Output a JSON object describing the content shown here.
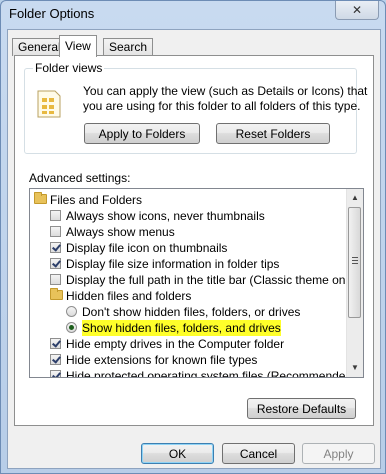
{
  "window": {
    "title": "Folder Options",
    "close_glyph": "✕"
  },
  "tabs": [
    {
      "label": "General",
      "active": false
    },
    {
      "label": "View",
      "active": true
    },
    {
      "label": "Search",
      "active": false
    }
  ],
  "folder_views": {
    "group_label": "Folder views",
    "description_line1": "You can apply the view (such as Details or Icons) that",
    "description_line2": "you are using for this folder to all folders of this type.",
    "apply_button": "Apply to Folders",
    "reset_button": "Reset Folders"
  },
  "advanced": {
    "label": "Advanced settings:",
    "items": [
      {
        "type": "folder",
        "label": "Files and Folders"
      },
      {
        "type": "checkbox",
        "checked": false,
        "label": "Always show icons, never thumbnails"
      },
      {
        "type": "checkbox",
        "checked": false,
        "label": "Always show menus"
      },
      {
        "type": "checkbox",
        "checked": true,
        "label": "Display file icon on thumbnails"
      },
      {
        "type": "checkbox",
        "checked": true,
        "label": "Display file size information in folder tips"
      },
      {
        "type": "checkbox",
        "checked": false,
        "label": "Display the full path in the title bar (Classic theme only)"
      },
      {
        "type": "folder",
        "label": "Hidden files and folders"
      },
      {
        "type": "radio",
        "checked": false,
        "label": "Don't show hidden files, folders, or drives"
      },
      {
        "type": "radio",
        "checked": true,
        "highlighted": true,
        "label": "Show hidden files, folders, and drives"
      },
      {
        "type": "checkbox",
        "checked": true,
        "label": "Hide empty drives in the Computer folder"
      },
      {
        "type": "checkbox",
        "checked": true,
        "label": "Hide extensions for known file types"
      },
      {
        "type": "checkbox",
        "checked": true,
        "label": "Hide protected operating system files (Recommended)"
      }
    ]
  },
  "restore_button": "Restore Defaults",
  "footer": {
    "ok": "OK",
    "cancel": "Cancel",
    "apply": "Apply"
  },
  "colors": {
    "highlight": "#ffff2a",
    "window_frame": "#b9d1ea"
  }
}
